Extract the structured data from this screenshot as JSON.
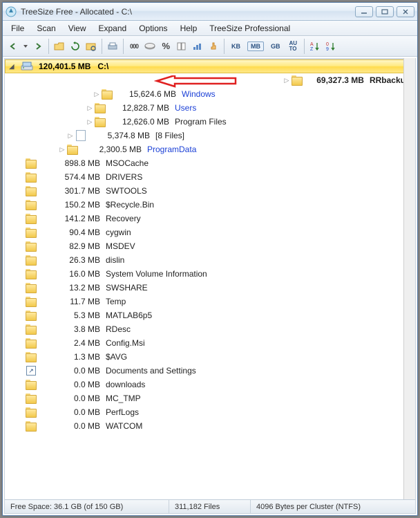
{
  "title": "TreeSize Free - Allocated - C:\\",
  "menu": [
    "File",
    "Scan",
    "View",
    "Expand",
    "Options",
    "Help",
    "TreeSize Professional"
  ],
  "toolbar": {
    "size_units": {
      "kb": "KB",
      "mb": "MB",
      "gb": "GB"
    },
    "auto": "AU\nTO",
    "percent": "%"
  },
  "root": {
    "size": "120,401.5 MB",
    "path": "C:\\"
  },
  "rows": [
    {
      "size": "69,327.3 MB",
      "name": "RRbackups",
      "icon": "folder",
      "bold": true,
      "shade": 396,
      "tri": true,
      "annot": true
    },
    {
      "size": "15,624.6 MB",
      "name": "Windows",
      "icon": "folder",
      "link": true,
      "shade": 110,
      "tri": true
    },
    {
      "size": "12,828.7 MB",
      "name": "Users",
      "icon": "folder",
      "link": true,
      "shade": 100,
      "tri": true
    },
    {
      "size": "12,626.0 MB",
      "name": "Program Files",
      "icon": "folder",
      "shade": 100,
      "tri": true
    },
    {
      "size": "5,374.8 MB",
      "name": "[8 Files]",
      "icon": "file",
      "shade": 72,
      "tri": true
    },
    {
      "size": "2,300.5 MB",
      "name": "ProgramData",
      "icon": "folder",
      "link": true,
      "shade": 60,
      "tri": true
    },
    {
      "size": "898.8 MB",
      "name": "MSOCache",
      "icon": "folder"
    },
    {
      "size": "574.4 MB",
      "name": "DRIVERS",
      "icon": "folder"
    },
    {
      "size": "301.7 MB",
      "name": "SWTOOLS",
      "icon": "folder"
    },
    {
      "size": "150.2 MB",
      "name": "$Recycle.Bin",
      "icon": "folder"
    },
    {
      "size": "141.2 MB",
      "name": "Recovery",
      "icon": "folder"
    },
    {
      "size": "90.4 MB",
      "name": "cygwin",
      "icon": "folder"
    },
    {
      "size": "82.9 MB",
      "name": "MSDEV",
      "icon": "folder"
    },
    {
      "size": "26.3 MB",
      "name": "dislin",
      "icon": "folder"
    },
    {
      "size": "16.0 MB",
      "name": "System Volume Information",
      "icon": "folder"
    },
    {
      "size": "13.2 MB",
      "name": "SWSHARE",
      "icon": "folder"
    },
    {
      "size": "11.7 MB",
      "name": "Temp",
      "icon": "folder"
    },
    {
      "size": "5.3 MB",
      "name": "MATLAB6p5",
      "icon": "folder"
    },
    {
      "size": "3.8 MB",
      "name": "RDesc",
      "icon": "folder"
    },
    {
      "size": "2.4 MB",
      "name": "Config.Msi",
      "icon": "folder"
    },
    {
      "size": "1.3 MB",
      "name": "$AVG",
      "icon": "folder"
    },
    {
      "size": "0.0 MB",
      "name": "Documents and Settings",
      "icon": "shortcut"
    },
    {
      "size": "0.0 MB",
      "name": "downloads",
      "icon": "folder"
    },
    {
      "size": "0.0 MB",
      "name": "MC_TMP",
      "icon": "folder"
    },
    {
      "size": "0.0 MB",
      "name": "PerfLogs",
      "icon": "folder"
    },
    {
      "size": "0.0 MB",
      "name": "WATCOM",
      "icon": "folder"
    }
  ],
  "status": {
    "free": "Free Space: 36.1 GB  (of 150 GB)",
    "files": "311,182  Files",
    "cluster": "4096 Bytes per Cluster (NTFS)"
  }
}
